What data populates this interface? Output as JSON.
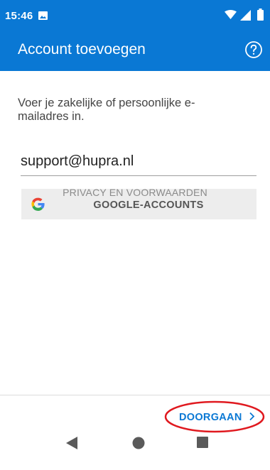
{
  "status_bar": {
    "time": "15:46",
    "icons": [
      "image-notification-icon",
      "wifi-icon",
      "signal-icon",
      "battery-icon"
    ]
  },
  "app_bar": {
    "title": "Account toevoegen",
    "help_icon": "help-circle-icon"
  },
  "form": {
    "instruction": "Voer je zakelijke of persoonlijke e-mailadres in.",
    "email_value": "support@hupra.nl",
    "google_button_label": "GOOGLE-ACCOUNTS",
    "privacy_link": "PRIVACY EN VOORWAARDEN"
  },
  "footer": {
    "continue_label": "DOORGAAN",
    "continue_icon": "chevron-right-icon"
  },
  "nav_bar": {
    "icons": [
      "back-icon",
      "home-icon",
      "recents-icon"
    ]
  },
  "colors": {
    "brand": "#0a78d4",
    "annotation": "#e0191f",
    "button_bg": "#ededed"
  }
}
